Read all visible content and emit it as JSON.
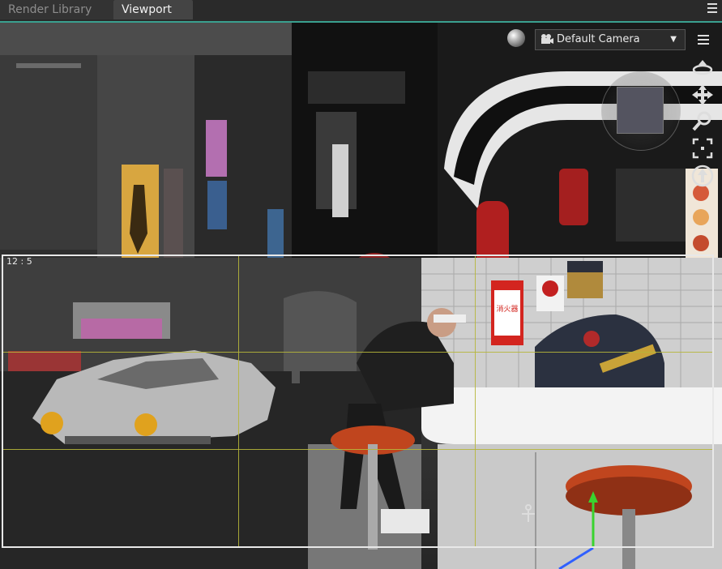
{
  "tabs": [
    {
      "label": "Render Library",
      "active": false
    },
    {
      "label": "Viewport",
      "active": true
    }
  ],
  "viewport": {
    "camera": {
      "selected": "Default Camera"
    },
    "frame_ratio_label": "12 : 5",
    "shading_icon": "shaded-sphere-icon",
    "nav_icons": [
      "orbit-icon",
      "pan-icon",
      "zoom-icon",
      "frame-icon",
      "aim-up-icon"
    ],
    "navigation_cube": true,
    "scene_signs": [
      "消火器"
    ],
    "colors": {
      "tab_accent": "#3aa08f",
      "frame": "#e8e8e8",
      "thirds_guides": "#b6b63a",
      "stool_top": "#c0451e",
      "gizmo_y": "#39d32f",
      "gizmo_z": "#3060ff"
    }
  }
}
